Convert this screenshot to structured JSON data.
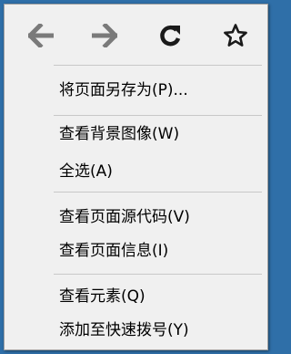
{
  "nav": {
    "back_icon": "arrow-left-icon",
    "forward_icon": "arrow-right-icon",
    "reload_icon": "reload-icon",
    "bookmark_icon": "star-icon",
    "disabled_color": "#7a7a7a",
    "active_color": "#1a1a1a"
  },
  "menu": {
    "items": [
      {
        "label": "将页面另存为(P)..."
      },
      {
        "label": "查看背景图像(W)"
      },
      {
        "label": "全选(A)"
      },
      {
        "label": "查看页面源代码(V)"
      },
      {
        "label": "查看页面信息(I)"
      },
      {
        "label": "查看元素(Q)"
      },
      {
        "label": "添加至快速拨号(Y)"
      }
    ]
  },
  "colors": {
    "menu_background": "#f0f0f0",
    "separator": "#c8c8c8",
    "backdrop": "#2f6fa8"
  }
}
